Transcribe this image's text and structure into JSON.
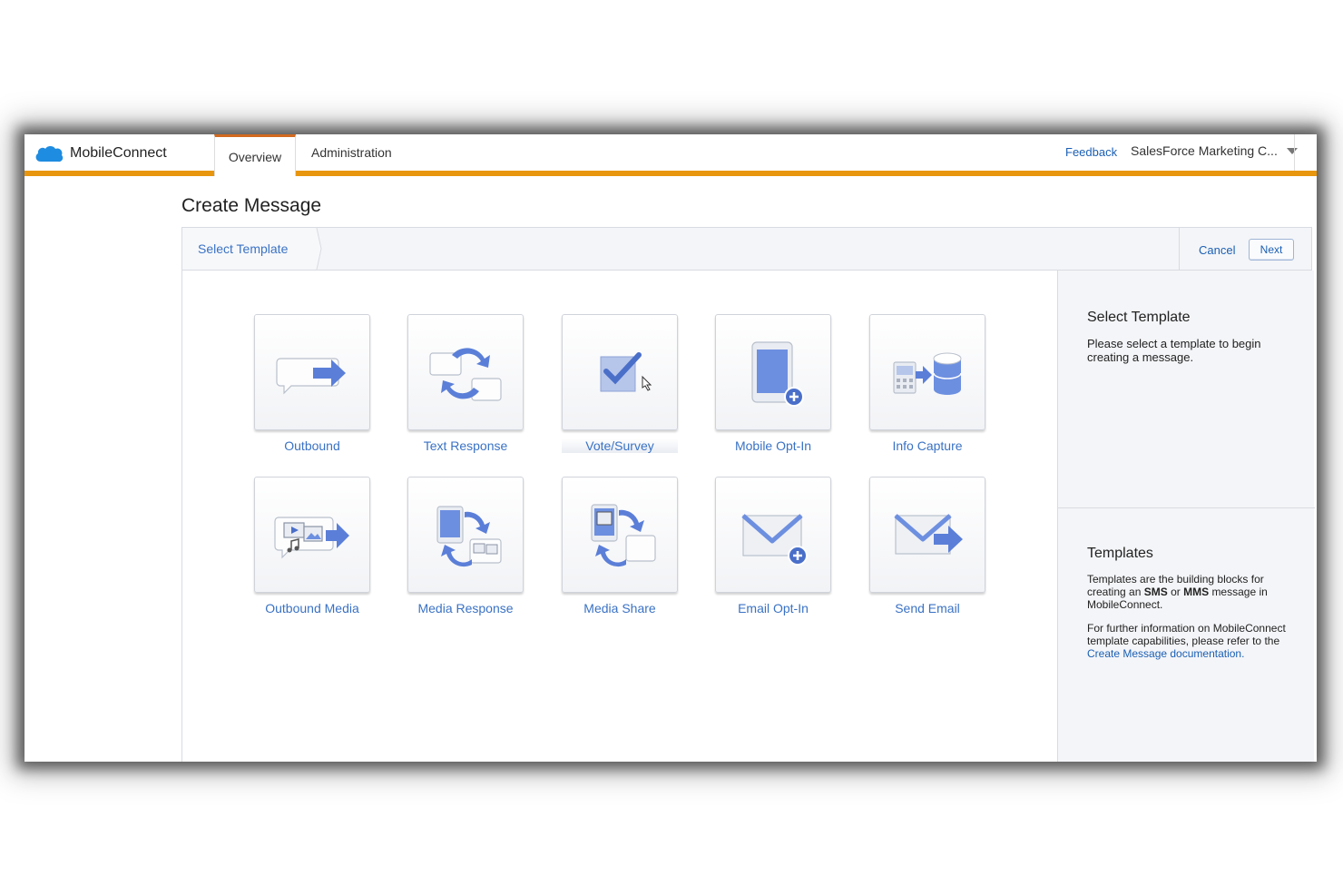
{
  "app": {
    "brand_name": "MobileConnect",
    "nav_tabs": [
      {
        "label": "Overview",
        "active": true
      },
      {
        "label": "Administration",
        "active": false
      }
    ],
    "feedback_label": "Feedback",
    "org_label": "SalesForce Marketing C...",
    "accent_color": "#e8960e"
  },
  "page": {
    "title": "Create Message"
  },
  "wizard": {
    "step_label": "Select Template",
    "cancel_label": "Cancel",
    "next_label": "Next"
  },
  "templates": [
    {
      "label": "Outbound",
      "icon": "outbound-icon"
    },
    {
      "label": "Text Response",
      "icon": "text-response-icon"
    },
    {
      "label": "Vote/Survey",
      "icon": "vote-survey-icon",
      "hovered": true
    },
    {
      "label": "Mobile Opt-In",
      "icon": "mobile-opt-in-icon"
    },
    {
      "label": "Info Capture",
      "icon": "info-capture-icon"
    },
    {
      "label": "Outbound Media",
      "icon": "outbound-media-icon"
    },
    {
      "label": "Media Response",
      "icon": "media-response-icon"
    },
    {
      "label": "Media Share",
      "icon": "media-share-icon"
    },
    {
      "label": "Email Opt-In",
      "icon": "email-opt-in-icon"
    },
    {
      "label": "Send Email",
      "icon": "send-email-icon"
    }
  ],
  "side_panel": {
    "select_heading": "Select Template",
    "select_text": "Please select a template to begin creating a message.",
    "templates_heading": "Templates",
    "templates_text_1": "Templates are the building blocks for creating an",
    "templates_sms": "SMS",
    "templates_or": "or",
    "templates_mms": "MMS",
    "templates_text_2": "message in MobileConnect.",
    "info_text": "For further information on MobileConnect template capabilities, please refer to the",
    "doc_link": "Create Message documentation",
    "info_end": "."
  }
}
